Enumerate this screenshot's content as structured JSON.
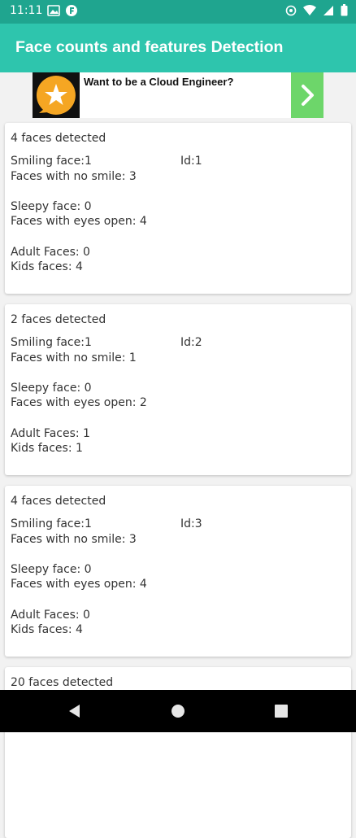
{
  "status_bar": {
    "time": "11:11"
  },
  "app_bar": {
    "title": "Face counts and features Detection"
  },
  "ad": {
    "text": "Want to be a Cloud Engineer?"
  },
  "cards": [
    {
      "faces_detected": "4 faces detected",
      "smiling": "Smiling face:1",
      "id": "Id:1",
      "no_smile": "Faces with no smile: 3",
      "sleepy": "Sleepy face: 0",
      "eyes_open": "Faces with eyes open: 4",
      "adult": "Adult Faces: 0",
      "kids": "Kids faces: 4"
    },
    {
      "faces_detected": "2 faces detected",
      "smiling": "Smiling face:1",
      "id": "Id:2",
      "no_smile": "Faces with no smile: 1",
      "sleepy": "Sleepy face: 0",
      "eyes_open": "Faces with eyes open: 2",
      "adult": "Adult Faces: 1",
      "kids": "Kids faces: 1"
    },
    {
      "faces_detected": "4 faces detected",
      "smiling": "Smiling face:1",
      "id": "Id:3",
      "no_smile": "Faces with no smile: 3",
      "sleepy": "Sleepy face: 0",
      "eyes_open": "Faces with eyes open: 4",
      "adult": "Adult Faces: 0",
      "kids": "Kids faces: 4"
    },
    {
      "faces_detected": "20 faces detected"
    }
  ],
  "colors": {
    "status_bar": "#1fa58f",
    "app_bar": "#2ec5ad",
    "ad_arrow": "#6dd66a",
    "ad_star": "#f5a623"
  },
  "icons": {
    "status_left": [
      "gallery-icon",
      "app-icon"
    ],
    "status_right": [
      "data-saver-icon",
      "wifi-icon",
      "signal-icon",
      "battery-icon"
    ],
    "nav": [
      "back-icon",
      "home-icon",
      "recents-icon"
    ]
  }
}
